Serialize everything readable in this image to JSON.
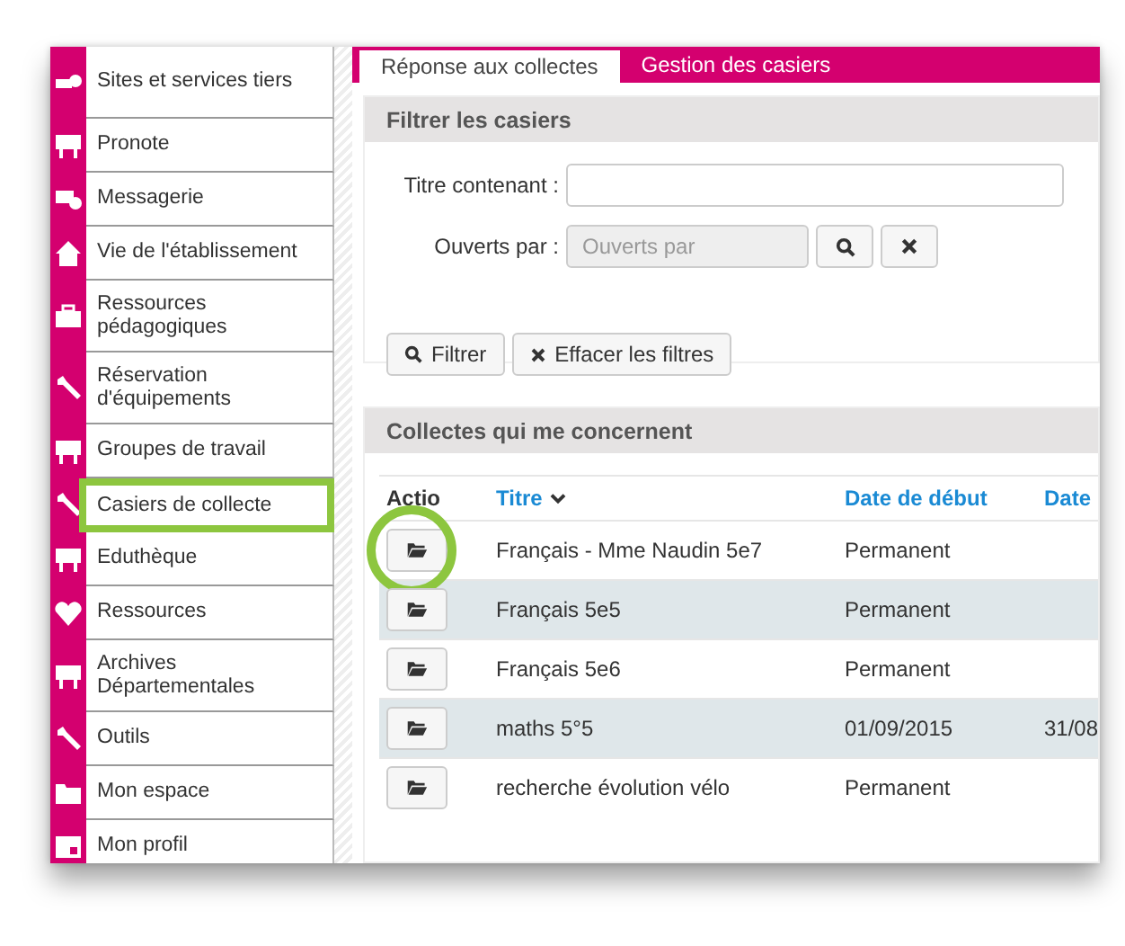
{
  "sidebar": {
    "items": [
      {
        "label": "Sites et services tiers",
        "highlighted": false
      },
      {
        "label": "Pronote",
        "highlighted": false
      },
      {
        "label": "Messagerie",
        "highlighted": false
      },
      {
        "label": "Vie de l'établissement",
        "highlighted": false
      },
      {
        "label": "Ressources pédagogiques",
        "highlighted": false
      },
      {
        "label": "Réservation d'équipements",
        "highlighted": false
      },
      {
        "label": "Groupes de travail",
        "highlighted": false
      },
      {
        "label": "Casiers de collecte",
        "highlighted": true
      },
      {
        "label": "Eduthèque",
        "highlighted": false
      },
      {
        "label": "Ressources",
        "highlighted": false
      },
      {
        "label": "Archives Départementales",
        "highlighted": false
      },
      {
        "label": "Outils",
        "highlighted": false
      },
      {
        "label": "Mon espace",
        "highlighted": false
      },
      {
        "label": "Mon profil",
        "highlighted": false
      }
    ]
  },
  "tabs": [
    {
      "label": "Réponse aux collectes",
      "selected": true
    },
    {
      "label": "Gestion des casiers",
      "selected": false
    }
  ],
  "filter_panel": {
    "title": "Filtrer les casiers",
    "title_field": {
      "label": "Titre contenant :"
    },
    "opened_by_field": {
      "label": "Ouverts par :",
      "placeholder": "Ouverts par"
    },
    "buttons": [
      "Filtrer",
      "Effacer les filtres"
    ]
  },
  "collections_panel": {
    "title": "Collectes qui me concernent",
    "table": {
      "columns": [
        {
          "label": "Actio",
          "sortable": false
        },
        {
          "label": "Titre",
          "sortable": true
        },
        {
          "label": "Date de début",
          "sortable": false
        },
        {
          "label": "Date",
          "sortable": false
        }
      ],
      "rows": [
        {
          "highlighted": true,
          "cells": [
            "",
            "Français - Mme Naudin 5e7",
            "Permanent",
            ""
          ]
        },
        {
          "highlighted": false,
          "cells": [
            "",
            "Français 5e5",
            "Permanent",
            ""
          ]
        },
        {
          "highlighted": false,
          "cells": [
            "",
            "Français 5e6",
            "Permanent",
            ""
          ]
        },
        {
          "highlighted": false,
          "cells": [
            "",
            "maths 5°5",
            "01/09/2015",
            "31/08"
          ]
        },
        {
          "highlighted": false,
          "cells": [
            "",
            "recherche évolution vélo",
            "Permanent",
            ""
          ]
        }
      ]
    }
  }
}
